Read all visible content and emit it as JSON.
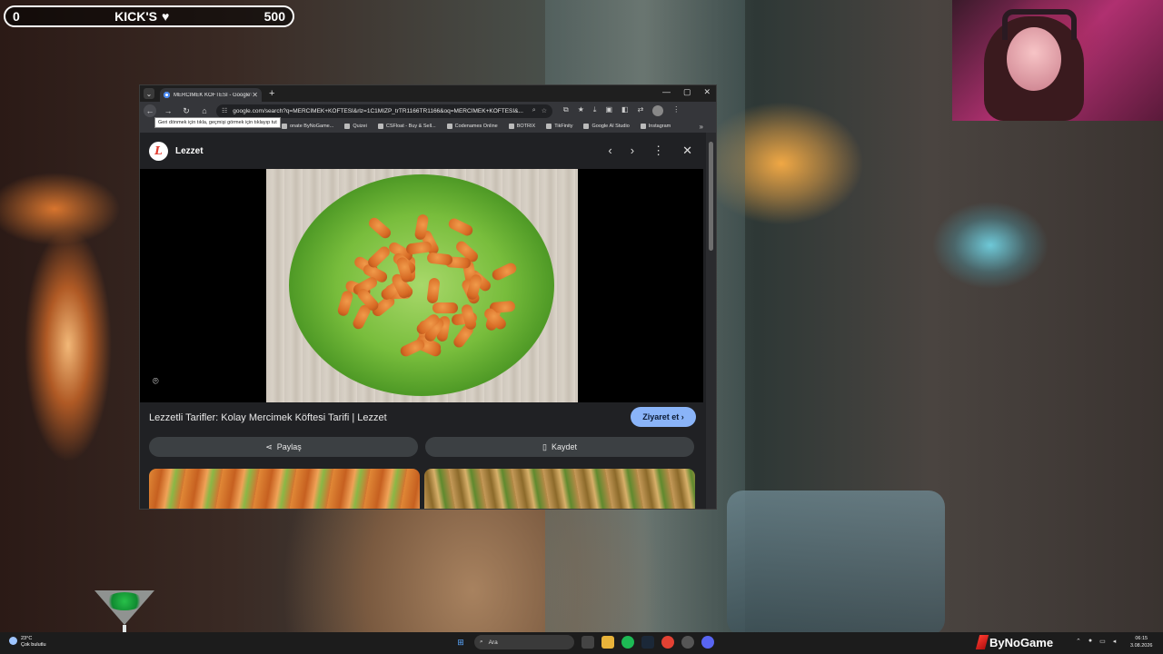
{
  "hud": {
    "left_score": "0",
    "title": "KICK'S",
    "right_score": "500"
  },
  "browser": {
    "tab_title": "MERCİMEK KÖFTESİ - Google'da Ara",
    "url": "google.com/search?q=MERCİMEK+KÖFTESİ&rlz=1C1MIZP_trTR1166TR1166&oq=MERCİMEK+KÖFTESİ&...",
    "tooltip": "Geri dönmek için tıkla, geçmişi görmek için tıklayıp tut",
    "bookmarks": [
      "onate ByNoGame...",
      "Quizei",
      "CSFloat - Buy & Sell...",
      "Codenames Online",
      "BOTRIX",
      "TikFinity",
      "Google AI Studio",
      "Instagram"
    ]
  },
  "viewer": {
    "source_name": "Lezzet",
    "logo_letter": "L",
    "result_title": "Lezzetli Tarifler: Kolay Mercimek Köftesi Tarifi | Lezzet",
    "visit_label": "Ziyaret et",
    "share_label": "Paylaş",
    "save_label": "Kaydet"
  },
  "taskbar": {
    "temperature": "23°C",
    "weather": "Çok bulutlu",
    "search_placeholder": "Ara",
    "brand": "ByNoGame",
    "time": "06:15",
    "date": "3.08.2026"
  },
  "icons": [
    "heart-icon",
    "back-icon",
    "forward-icon",
    "reload-icon",
    "home-icon",
    "star-icon",
    "close-icon",
    "more-icon",
    "share-icon",
    "bookmark-icon",
    "lens-icon",
    "chevron-left-icon",
    "chevron-right-icon"
  ]
}
